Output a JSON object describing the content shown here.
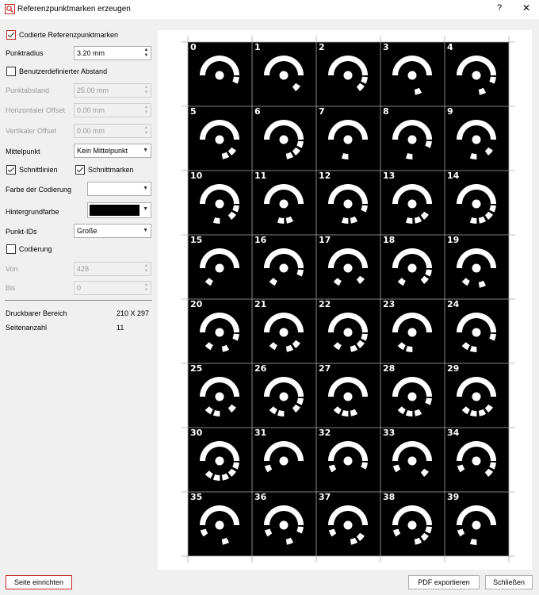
{
  "window": {
    "title": "Referenzpunktmarken erzeugen",
    "help": "?",
    "close": "✕"
  },
  "icons": {
    "app": "search-magnifier-icon",
    "check": "checkmark-icon",
    "dropdown": "chevron-down-icon",
    "spin_up": "arrow-up-icon",
    "spin_down": "arrow-down-icon"
  },
  "form": {
    "coded_markers": {
      "label": "Codierte Referenzpunktmarken",
      "checked": true
    },
    "point_radius": {
      "label": "Punktradius",
      "value": "3.20 mm"
    },
    "custom_spacing": {
      "label": "Benutzerdefinierter Abstand",
      "checked": false
    },
    "point_spacing": {
      "label": "Punktabstand",
      "value": "25.00 mm"
    },
    "h_offset": {
      "label": "Horizontaler Offset",
      "value": "0.00 mm"
    },
    "v_offset": {
      "label": "Vertikaler Offset",
      "value": "0.00 mm"
    },
    "center": {
      "label": "Mittelpunkt",
      "value": "Kein Mittelpunkt"
    },
    "cut_lines": {
      "label": "Schnittlinien",
      "checked": true
    },
    "cut_marks": {
      "label": "Schnittmarken",
      "checked": true
    },
    "coding_color": {
      "label": "Farbe der Codierung",
      "value": "#ffffff"
    },
    "bg_color": {
      "label": "Hintergrundfarbe",
      "value": "#000000"
    },
    "point_ids": {
      "label": "Punkt-IDs",
      "value": "Große"
    },
    "coding": {
      "label": "Codierung",
      "checked": false
    },
    "from": {
      "label": "Von",
      "value": "428"
    },
    "to": {
      "label": "Bis",
      "value": "0"
    }
  },
  "info": {
    "print_area_label": "Druckbarer Bereich",
    "print_area_value": "210 X 297",
    "page_count_label": "Seitenanzahl",
    "page_count_value": "11"
  },
  "buttons": {
    "page_setup": "Seite einrichten",
    "export_pdf": "PDF exportieren",
    "close": "Schließen"
  },
  "preview": {
    "grid_cols": 5,
    "grid_rows": 8,
    "marker_ids": [
      "0",
      "1",
      "2",
      "3",
      "4",
      "5",
      "6",
      "7",
      "8",
      "9",
      "10",
      "11",
      "12",
      "13",
      "14",
      "15",
      "16",
      "17",
      "18",
      "19",
      "20",
      "21",
      "22",
      "23",
      "24",
      "25",
      "26",
      "27",
      "28",
      "29",
      "30",
      "31",
      "32",
      "33",
      "34",
      "35",
      "36",
      "37",
      "38",
      "39"
    ],
    "marker_color": "#ffffff",
    "background": "#000000"
  }
}
